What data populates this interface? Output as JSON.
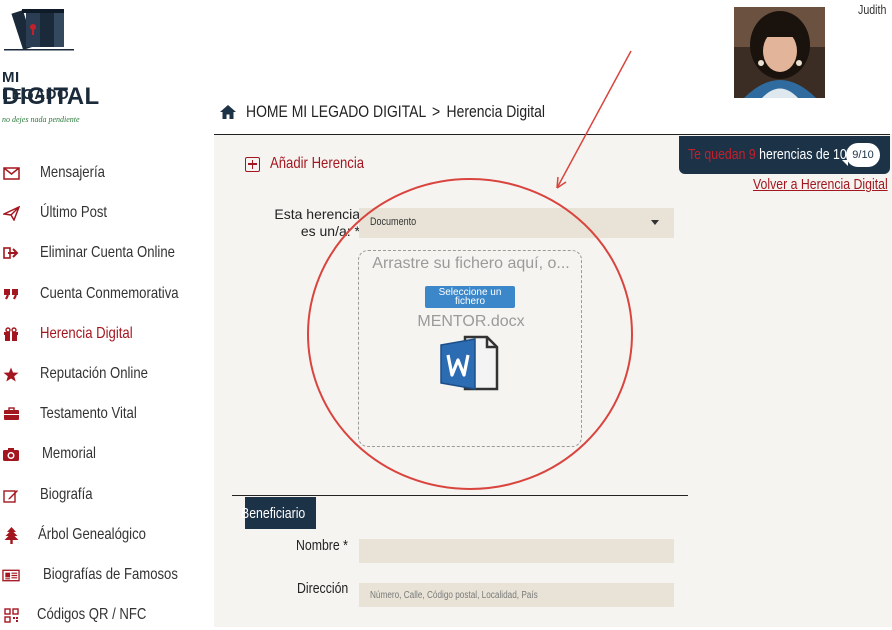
{
  "logo": {
    "line1": "MI LEGADO",
    "line2": "DIGITAL",
    "tagline": "no dejes nada pendiente"
  },
  "user": {
    "name": "Judith"
  },
  "breadcrumb": {
    "home": "HOME MI LEGADO DIGITAL",
    "separator": ">",
    "current": "Herencia Digital"
  },
  "sidebar": {
    "items": [
      {
        "label": "Mensajería",
        "icon": "envelope-icon"
      },
      {
        "label": "Último Post",
        "icon": "paper-plane-icon"
      },
      {
        "label": "Eliminar Cuenta Online",
        "icon": "sign-out-icon"
      },
      {
        "label": "Cuenta Conmemorativa",
        "icon": "quote-icon"
      },
      {
        "label": "Herencia Digital",
        "icon": "gift-icon",
        "active": true
      },
      {
        "label": "Reputación Online",
        "icon": "star-icon"
      },
      {
        "label": "Testamento Vital",
        "icon": "briefcase-icon"
      },
      {
        "label": "Memorial",
        "icon": "camera-icon"
      },
      {
        "label": "Biografía",
        "icon": "edit-icon"
      },
      {
        "label": "Árbol Genealógico",
        "icon": "tree-icon"
      },
      {
        "label": "Biografías de Famosos",
        "icon": "newspaper-icon"
      },
      {
        "label": "Códigos QR / NFC",
        "icon": "qrcode-icon"
      }
    ]
  },
  "quota": {
    "prefix": "Te quedan",
    "count": "9",
    "suffix": "herencias de 10.",
    "badge": "9/10"
  },
  "back_link": "Volver a Herencia Digital",
  "add_herencia": "Añadir Herencia",
  "form": {
    "type_label": "Esta herencia es un/a: *",
    "type_value": "Documento",
    "dropzone": {
      "hint": "Arrastre su fichero aquí, o...",
      "button": "Seleccione un fichero",
      "file_name": "MENTOR.docx"
    },
    "beneficiary_tab": "Beneficiario",
    "name_label": "Nombre *",
    "address_label": "Dirección",
    "address_placeholder": "Número, Calle, Código postal, Localidad, País"
  },
  "colors": {
    "brand_red": "#a4161f",
    "navy": "#1c3247",
    "field_bg": "#e8e3d6",
    "annotation_red": "#d9453e"
  }
}
